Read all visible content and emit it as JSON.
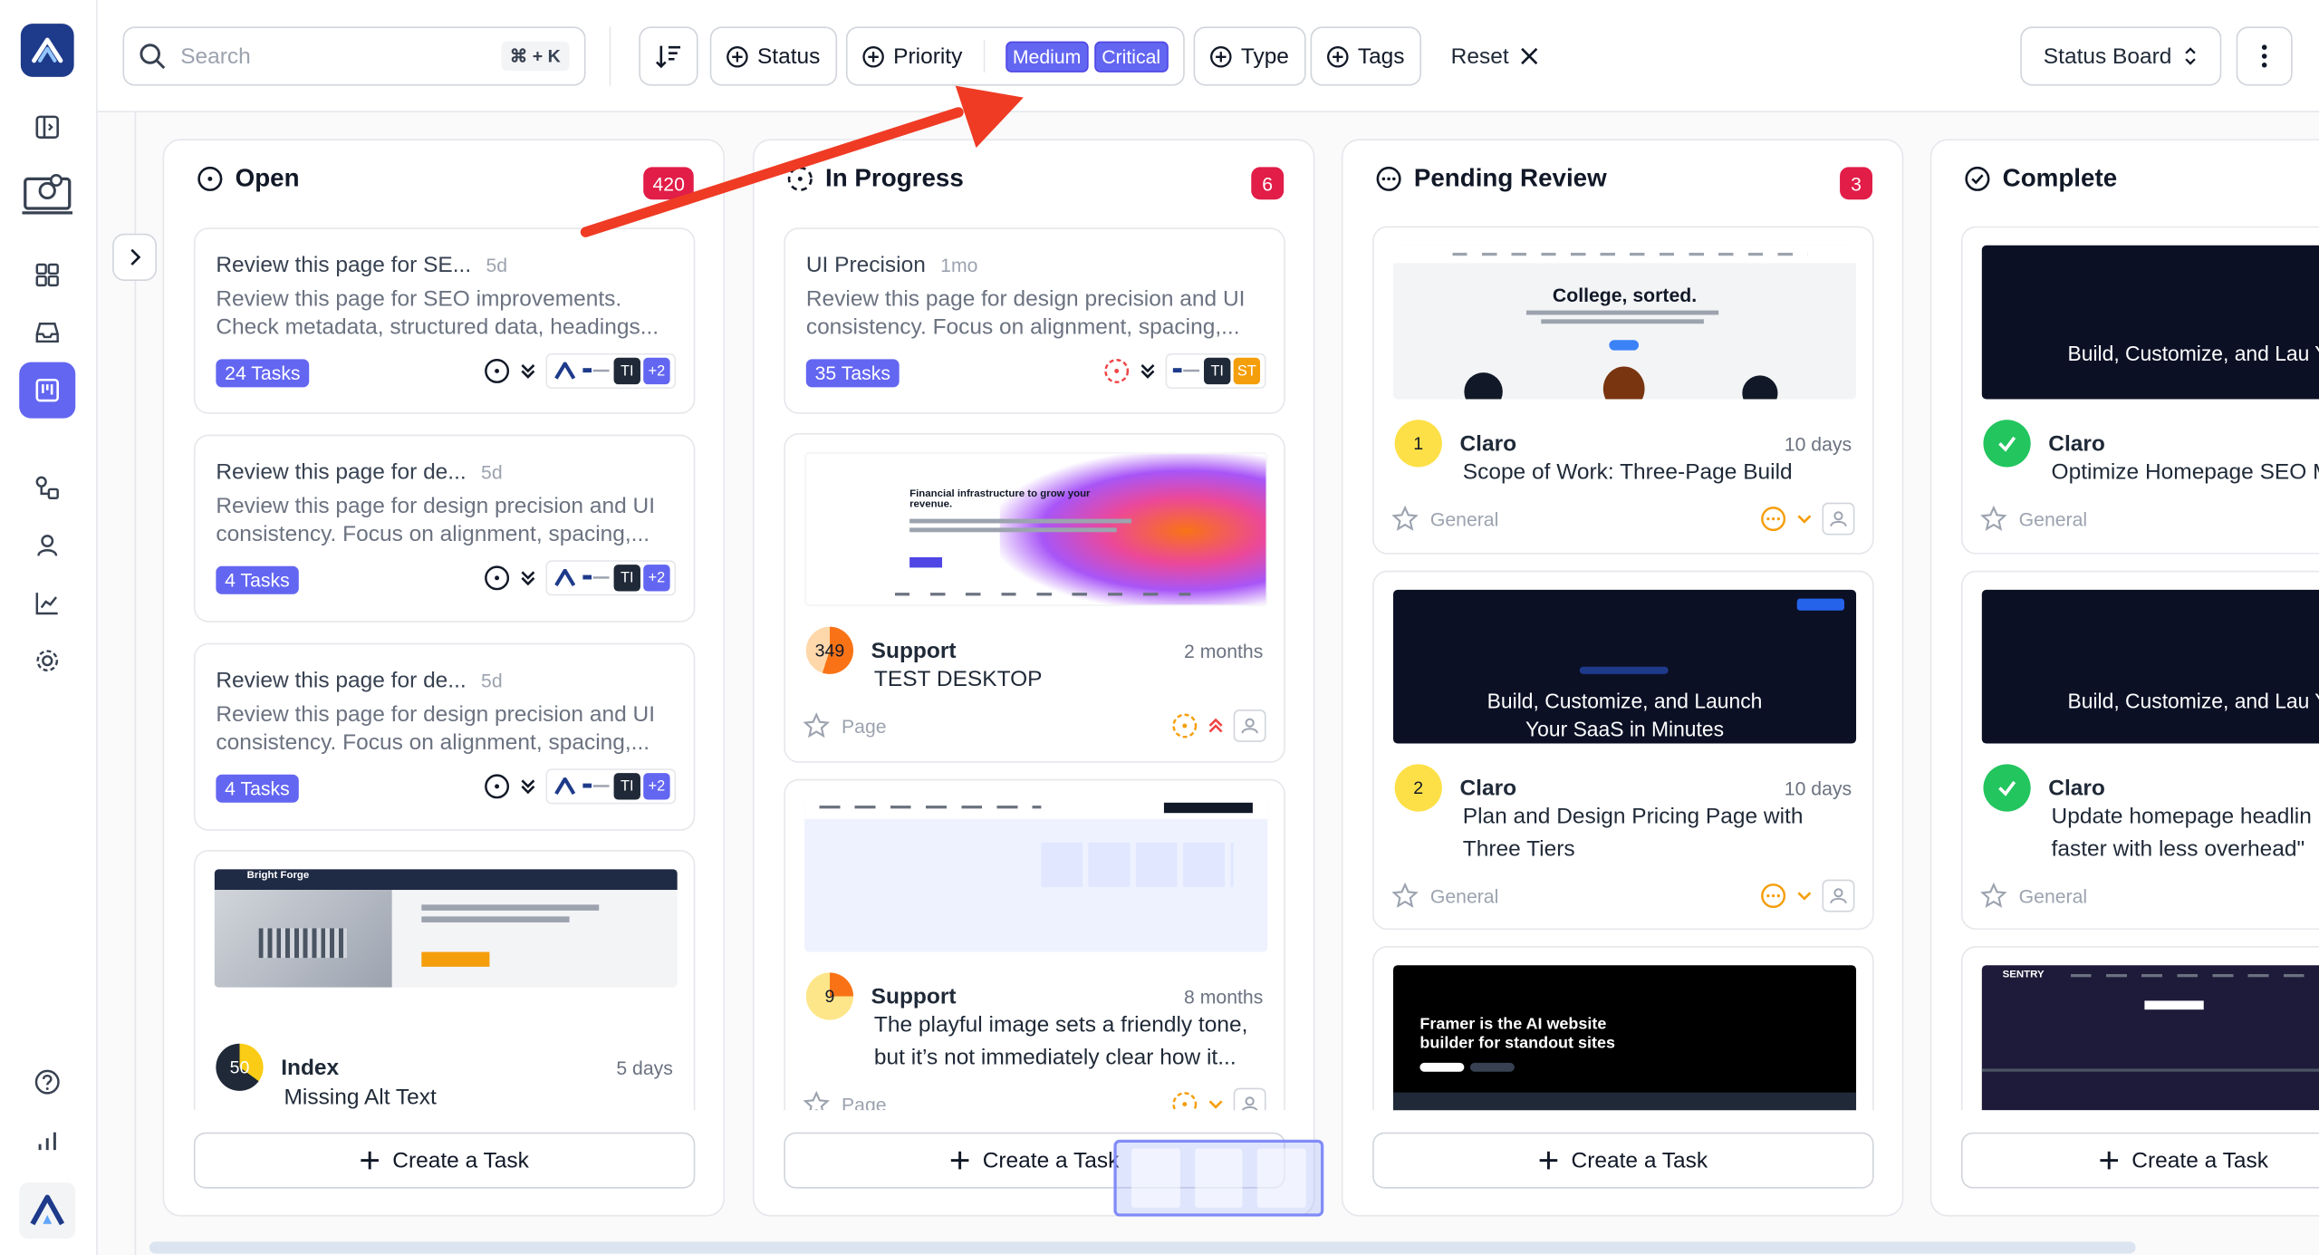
{
  "search": {
    "placeholder": "Search",
    "shortcut": "⌘ + K"
  },
  "filters": {
    "status": "Status",
    "priority": "Priority",
    "priority_chips": [
      "Medium",
      "Critical"
    ],
    "type": "Type",
    "tags": "Tags",
    "reset": "Reset"
  },
  "view": {
    "label": "Status Board"
  },
  "colors": {
    "accent": "#6366f1",
    "count_badge": "#e11d48",
    "logo": "#1e3a8a"
  },
  "columns": [
    {
      "title": "Open",
      "count": "420",
      "create": "Create a Task",
      "cards": [
        {
          "title": "Review this page for SE...",
          "age": "5d",
          "desc1": "Review this page for SEO improvements.",
          "desc2": "Check metadata, structured data, headings...",
          "tasks": "24 Tasks",
          "avatars": [
            "TI",
            "+2"
          ]
        },
        {
          "title": "Review this page for de...",
          "age": "5d",
          "desc1": "Review this page for design precision and UI",
          "desc2": "consistency. Focus on alignment, spacing,...",
          "tasks": "4 Tasks",
          "avatars": [
            "TI",
            "+2"
          ]
        },
        {
          "title": "Review this page for de...",
          "age": "5d",
          "desc1": "Review this page for design precision and UI",
          "desc2": "consistency. Focus on alignment, spacing,...",
          "tasks": "4 Tasks",
          "avatars": [
            "TI",
            "+2"
          ]
        },
        {
          "name": "Index",
          "time": "5 days",
          "badge": "50",
          "title": "Missing Alt Text",
          "thumb_brand": "Bright Forge"
        }
      ]
    },
    {
      "title": "In Progress",
      "count": "6",
      "create": "Create a Task",
      "cards": [
        {
          "title": "UI Precision",
          "age": "1mo",
          "desc1": "Review this page for design precision and UI",
          "desc2": "consistency. Focus on alignment, spacing,...",
          "tasks": "35 Tasks",
          "avatars": [
            "TI",
            "ST"
          ]
        },
        {
          "name": "Support",
          "time": "2 months",
          "badge": "349",
          "title": "TEST DESKTOP",
          "category": "Page",
          "thumb_text": "Financial infrastructure to grow your revenue."
        },
        {
          "name": "Support",
          "time": "8 months",
          "badge": "9",
          "title": "The playful image sets a friendly tone, but it’s not immediately clear how it...",
          "category": "Page"
        }
      ]
    },
    {
      "title": "Pending Review",
      "count": "3",
      "create": "Create a Task",
      "cards": [
        {
          "name": "Claro",
          "time": "10 days",
          "badge": "1",
          "title": "Scope of Work: Three-Page Build",
          "category": "General",
          "thumb_text": "College, sorted."
        },
        {
          "name": "Claro",
          "time": "10 days",
          "badge": "2",
          "title": "Plan and Design Pricing Page with Three Tiers",
          "category": "General",
          "thumb_text": "Build, Customize, and Launch Your SaaS in Minutes"
        },
        {
          "thumb_text": "Framer is the AI website builder for standout sites"
        }
      ]
    },
    {
      "title": "Complete",
      "create": "Create a Task",
      "cards": [
        {
          "name": "Claro",
          "title": "Optimize Homepage SEO M",
          "category": "General",
          "thumb_text": "Build, Customize, and Lau Your SaaS in Minutes"
        },
        {
          "name": "Claro",
          "title": "Update homepage headlin faster with less overhead\"",
          "category": "General",
          "thumb_text": "Build, Customize, and Lau Your SaaS in Minutes"
        },
        {
          "thumb_brand": "SENTRY"
        }
      ]
    }
  ]
}
